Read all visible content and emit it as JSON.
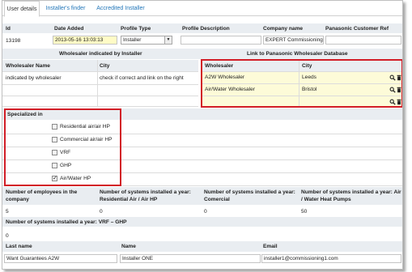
{
  "tabs": [
    "User details",
    "Installer's finder",
    "Accredited Installer"
  ],
  "user": {
    "headers": [
      "Id",
      "Date Added",
      "Profile Type",
      "Profile Description",
      "Company name",
      "Panasonic Customer Ref"
    ],
    "id": "13198",
    "date_added": "2013-05-16 13:03:13",
    "profile_type": "Installer",
    "profile_description": "",
    "company_name": "EXPERT Commissioning",
    "customer_ref": ""
  },
  "wholesaler": {
    "left_title": "Wholesaler indicated by Installer",
    "right_title": "Link to Panasonic Wholesaler Database",
    "left_headers": [
      "Wholesaler Name",
      "City"
    ],
    "left_name_value": "indicated by wholesaler",
    "left_city_value": "check if correct and link on the right",
    "right_headers": [
      "Wholesaler",
      "City"
    ],
    "rows": [
      {
        "wholesaler": "A2W Wholesaler",
        "city": "Leeds"
      },
      {
        "wholesaler": "Air/Water Wholesaler",
        "city": "Bristol"
      },
      {
        "wholesaler": "",
        "city": ""
      }
    ],
    "search_icon": "magnifier-icon",
    "delete_icon": "trash-icon"
  },
  "specialized": {
    "title": "Specialized in",
    "options": [
      {
        "label": "Residential air/air HP",
        "checked": false
      },
      {
        "label": "Commercial air/air HP",
        "checked": false
      },
      {
        "label": "VRF",
        "checked": false
      },
      {
        "label": "GHP",
        "checked": false
      },
      {
        "label": "Air/Water HP",
        "checked": true
      }
    ]
  },
  "stats": {
    "headers": [
      "Number of employees in the company",
      "Number of systems installed a year: Residential Air / Air HP",
      "Number of systems installed a year: Comercial",
      "Number of systems installed a year: Air / Water Heat Pumps"
    ],
    "values": [
      "5",
      "0",
      "0",
      "50"
    ],
    "vrf_header": "Number of systems installed a year: VRF – GHP",
    "vrf_value": "0"
  },
  "contact": {
    "headers": [
      "Last name",
      "Name",
      "Email"
    ],
    "last_name": "Want Guarantees A2W",
    "name": "Installer ONE",
    "email": "installer1@commissioning1.com"
  },
  "colors": {
    "highlight_border": "#d21e27",
    "link": "#1f74b8",
    "section_band": "#e9edf1",
    "yellow_input": "#fffbc6"
  }
}
